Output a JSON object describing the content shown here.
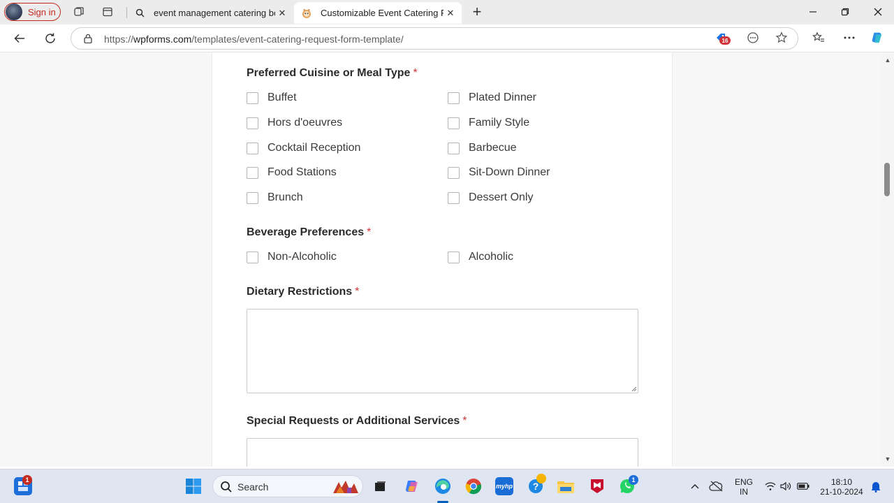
{
  "browser": {
    "signin_label": "Sign in",
    "tabs": [
      {
        "title": "event management catering book",
        "favicon": "search-icon",
        "active": false
      },
      {
        "title": "Customizable Event Catering Request Form Template",
        "favicon": "wpforms-favicon",
        "active": true
      }
    ],
    "url_prefix": "https://",
    "url_domain": "wpforms.com",
    "url_path": "/templates/event-catering-request-form-template/",
    "extension_badge": "16",
    "accent_color": "#c42b1c"
  },
  "form": {
    "required_marker": "*",
    "cuisine": {
      "label": "Preferred Cuisine or Meal Type",
      "options_col1": [
        "Buffet",
        "Hors d'oeuvres",
        "Cocktail Reception",
        "Food Stations",
        "Brunch"
      ],
      "options_col2": [
        "Plated Dinner",
        "Family Style",
        "Barbecue",
        "Sit-Down Dinner",
        "Dessert Only"
      ]
    },
    "beverage": {
      "label": "Beverage Preferences",
      "options": [
        "Non-Alcoholic",
        "Alcoholic"
      ]
    },
    "dietary": {
      "label": "Dietary Restrictions",
      "value": ""
    },
    "special": {
      "label": "Special Requests or Additional Services",
      "value": ""
    },
    "required_color": "#d63638"
  },
  "taskbar": {
    "widgets_badge": "1",
    "search_placeholder": "Search",
    "whatsapp_badge": "1",
    "lang_top": "ENG",
    "lang_bottom": "IN",
    "time": "18:10",
    "date": "21-10-2024"
  }
}
